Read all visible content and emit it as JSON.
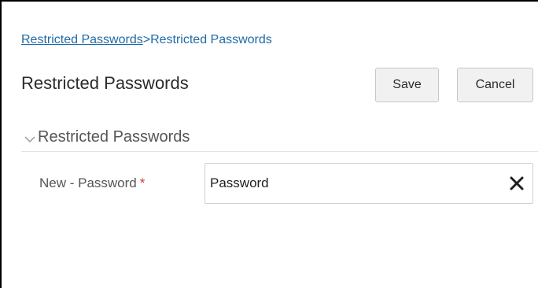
{
  "breadcrumb": {
    "link_label": "Restricted Passwords",
    "separator": ">",
    "current_label": "Restricted Passwords"
  },
  "header": {
    "title": "Restricted Passwords",
    "save_label": "Save",
    "cancel_label": "Cancel"
  },
  "section": {
    "title": "Restricted Passwords",
    "expanded": true,
    "toggle_icon": "chevron-down-icon"
  },
  "form": {
    "new_password": {
      "label": "New - Password",
      "required_marker": "*",
      "value": "Password",
      "clear_icon": "clear-x-icon"
    }
  },
  "colors": {
    "link": "#1e6aa8",
    "required": "#d63b3b",
    "text": "#2b2b2b",
    "muted_text": "#555555",
    "button_bg": "#f1f1f1",
    "border": "#d0d0d0"
  }
}
